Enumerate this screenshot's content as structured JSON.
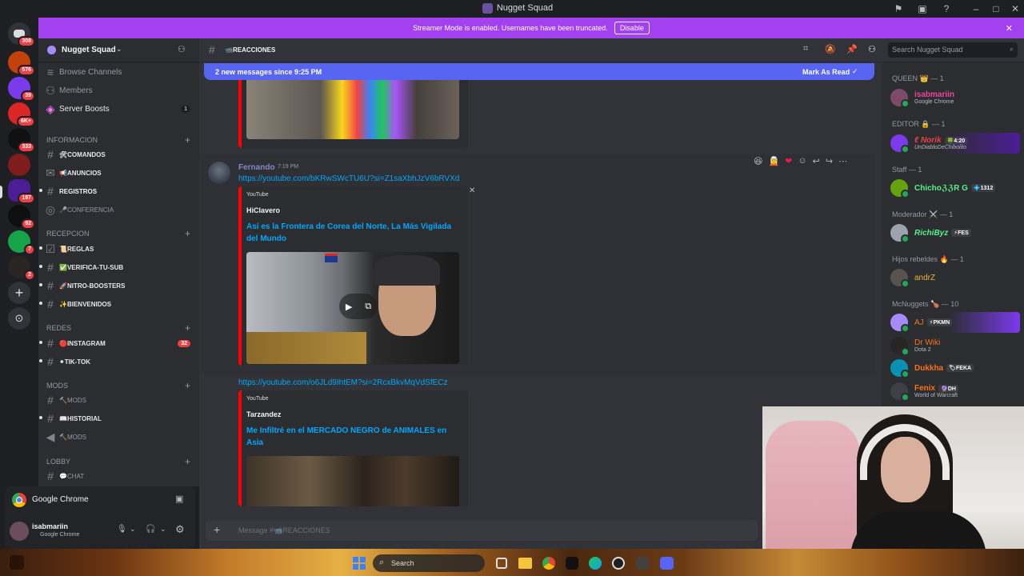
{
  "window": {
    "title": "Nugget Squad"
  },
  "banner": {
    "text": "Streamer Mode is enabled. Usernames have been truncated.",
    "disable_label": "Disable"
  },
  "rail": {
    "badges": [
      "308",
      "576",
      "39",
      "6K+",
      "333",
      "197",
      "92",
      "7",
      "2"
    ]
  },
  "server": {
    "name": "Nugget Squad",
    "top_items": [
      {
        "label": "Browse Channels"
      },
      {
        "label": "Members"
      },
      {
        "label": "Server Boosts",
        "count": "1"
      }
    ],
    "categories": [
      {
        "name": "INFORMACION",
        "channels": [
          "🛠COMANDOS",
          "📢ANUNCIOS",
          "REGISTROS",
          "🎤CONFERENCIA"
        ]
      },
      {
        "name": "RECEPCION",
        "channels": [
          "📜REGLAS",
          "✅VERIFICA-TU-SUB",
          "🚀NITRO-BOOSTERS",
          "✨BIENVENIDOS"
        ]
      },
      {
        "name": "REDES",
        "channels": [
          "🔴INSTAGRAM",
          "⚫TIK-TOK"
        ],
        "instagram_badge": "32"
      },
      {
        "name": "MODS",
        "channels": [
          "🔨MODS",
          "📖HISTORIAL",
          "🔨MODS"
        ]
      },
      {
        "name": "LOBBY",
        "channels": [
          "💬CHAT"
        ]
      }
    ]
  },
  "activity": {
    "app": "Google Chrome"
  },
  "user": {
    "name": "isabmariin",
    "status": "Google Chrome"
  },
  "chat": {
    "channel": "📹REACCIONES",
    "search_placeholder": "Search Nugget Squad",
    "new_messages": "2 new messages since 9:25 PM",
    "mark_read": "Mark As Read",
    "message": {
      "author": "Fernando",
      "time": "7:19 PM",
      "link1": "https://youtube.com/bKRwSWcTU6U?si=Z1saXbhJzV6bRVXd",
      "embed1": {
        "provider": "YouTube",
        "channel": "HiClavero",
        "title": "Así es la Frontera de Corea del Norte, La Más Vigilada del Mundo"
      },
      "link2": "https://youtube.com/o6JLd9IhtEM?si=2RcxBkvMqVdSfECz",
      "embed2": {
        "provider": "YouTube",
        "channel": "Tarzandez",
        "title": "Me Infiltré en el MERCADO NEGRO de ANIMALES en Asia"
      }
    },
    "composer_placeholder": "Message #📹REACCIONES"
  },
  "members": {
    "groups": [
      {
        "label": "QUEEN 👑 — 1",
        "members": [
          {
            "name": "isabmariin",
            "activity": "Google Chrome",
            "color": "#eb459e"
          }
        ]
      },
      {
        "label": "EDITOR 🔒 — 1",
        "members": [
          {
            "name": "ℓ Norik",
            "tag": "🍀4:20",
            "activity": "UnDiabloDeChibolito",
            "color": "#f23f43"
          }
        ]
      },
      {
        "label": "Staff — 1",
        "members": [
          {
            "name": "ChichoℨℨR G",
            "tag": "💠1312",
            "color": "#57f287"
          }
        ]
      },
      {
        "label": "Moderador ⚔️ — 1",
        "members": [
          {
            "name": "RichiByz",
            "tag": "⚡FES",
            "color": "#57f287"
          }
        ]
      },
      {
        "label": "Hijos rebeldes 🔥 — 1",
        "members": [
          {
            "name": "andrZ",
            "color": "#f0b232"
          }
        ]
      },
      {
        "label": "McNuggets 🍗 — 10",
        "members": [
          {
            "name": "AJ",
            "tag": "⚡PKMN",
            "color": "#f97316"
          },
          {
            "name": "Dr Wiki",
            "activity": "Dota 2",
            "color": "#f97316"
          },
          {
            "name": "Dukkha",
            "tag": "🏷FEKA",
            "color": "#f97316"
          },
          {
            "name": "Fenix",
            "tag": "🔮DH",
            "activity": "World of Warcraft",
            "color": "#f97316"
          }
        ]
      }
    ]
  },
  "taskbar": {
    "search": "Search"
  },
  "colors": {
    "blurple": "#5865f2",
    "streamer_banner": "#a340f0",
    "embed_bar": "#ff0000",
    "link": "#00a8fc"
  }
}
